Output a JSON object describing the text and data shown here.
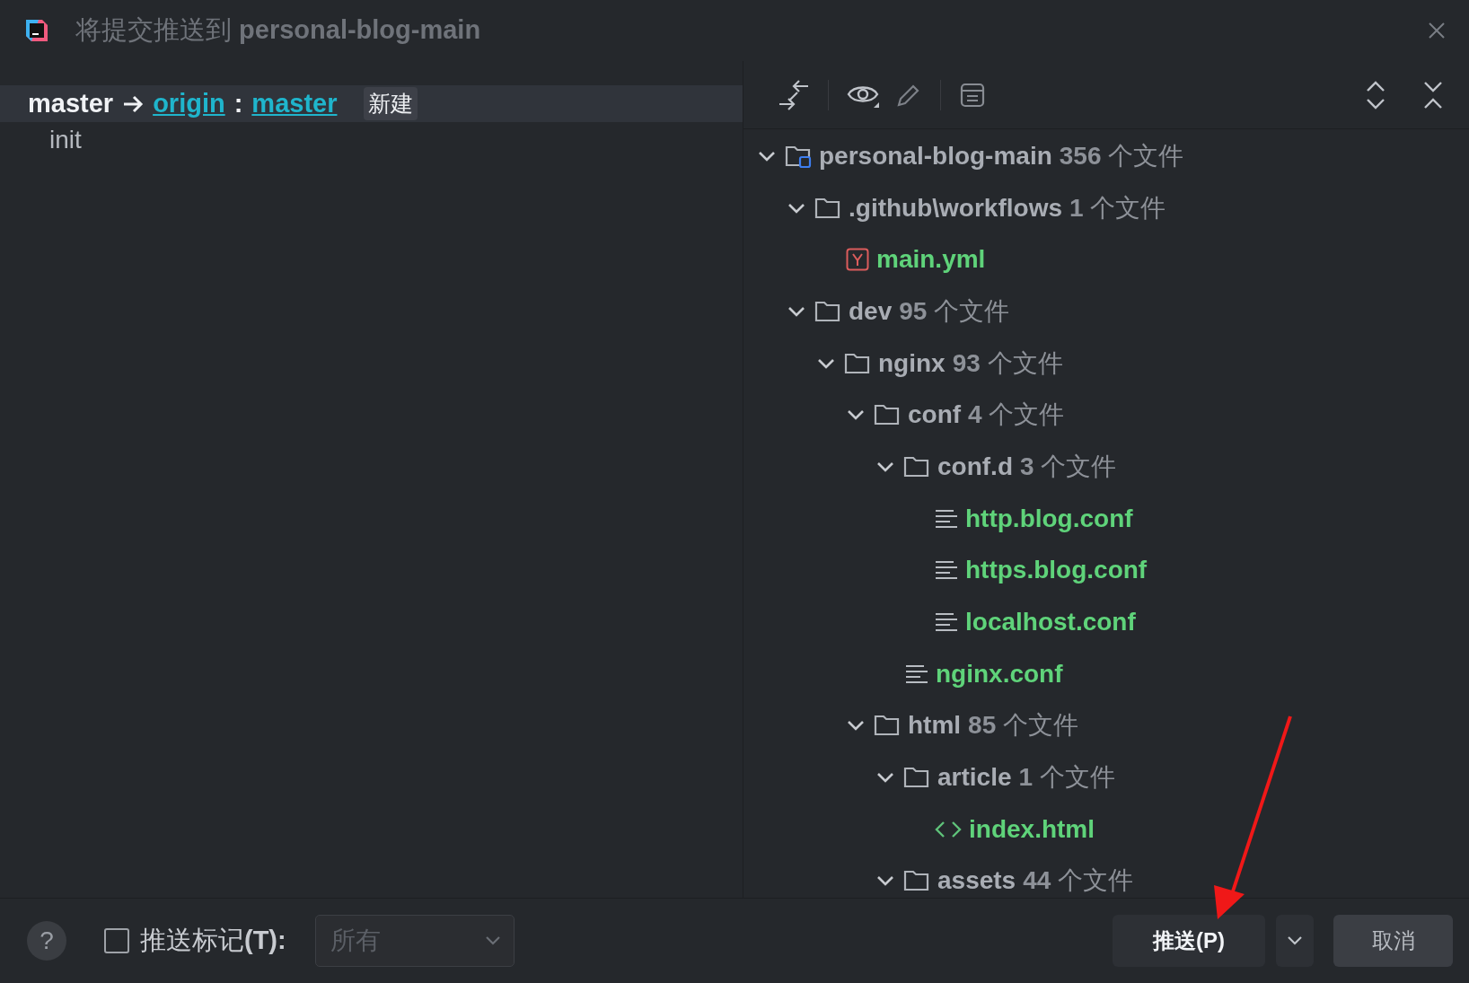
{
  "window": {
    "title": "将提交推送到 **personal-blog-main**"
  },
  "push_target": {
    "local": "master",
    "remote": "origin",
    "separator": ":",
    "branch": "master",
    "badge": "新建"
  },
  "commits": [
    {
      "message": "init"
    }
  ],
  "tree": [
    {
      "kind": "project",
      "name": "personal-blog-main",
      "count": "**356** 个文件",
      "expanded": true,
      "children": [
        {
          "kind": "folder",
          "name": ".github\\workflows",
          "count": "**1** 个文件",
          "expanded": true,
          "children": [
            {
              "kind": "yml",
              "name": "main.yml"
            }
          ]
        },
        {
          "kind": "folder",
          "name": "dev",
          "count": "**95** 个文件",
          "expanded": true,
          "children": [
            {
              "kind": "folder",
              "name": "nginx",
              "count": "**93** 个文件",
              "expanded": true,
              "children": [
                {
                  "kind": "folder",
                  "name": "conf",
                  "count": "**4** 个文件",
                  "expanded": true,
                  "children": [
                    {
                      "kind": "folder",
                      "name": "conf.d",
                      "count": "**3** 个文件",
                      "expanded": true,
                      "children": [
                        {
                          "kind": "text",
                          "name": "http.blog.conf"
                        },
                        {
                          "kind": "text",
                          "name": "https.blog.conf"
                        },
                        {
                          "kind": "text",
                          "name": "localhost.conf"
                        }
                      ]
                    },
                    {
                      "kind": "text",
                      "name": "nginx.conf"
                    }
                  ]
                },
                {
                  "kind": "folder",
                  "name": "html",
                  "count": "**85** 个文件",
                  "expanded": true,
                  "children": [
                    {
                      "kind": "folder",
                      "name": "article",
                      "count": "**1** 个文件",
                      "expanded": true,
                      "children": [
                        {
                          "kind": "html",
                          "name": "index.html"
                        }
                      ]
                    },
                    {
                      "kind": "folder",
                      "name": "assets",
                      "count": "**44** 个文件",
                      "expanded": true
                    }
                  ]
                }
              ]
            }
          ]
        }
      ]
    }
  ],
  "footer": {
    "help": "?",
    "push_tags": {
      "label": "推送标记**(T):**",
      "checked": false
    },
    "tags_select": {
      "value": "所有",
      "disabled": true
    },
    "buttons": [
      {
        "kind": "primary",
        "label": "推送(P)"
      },
      {
        "kind": "menu"
      },
      {
        "kind": "secondary",
        "label": "取消"
      }
    ]
  },
  "annotation": {
    "kind": "arrow"
  }
}
